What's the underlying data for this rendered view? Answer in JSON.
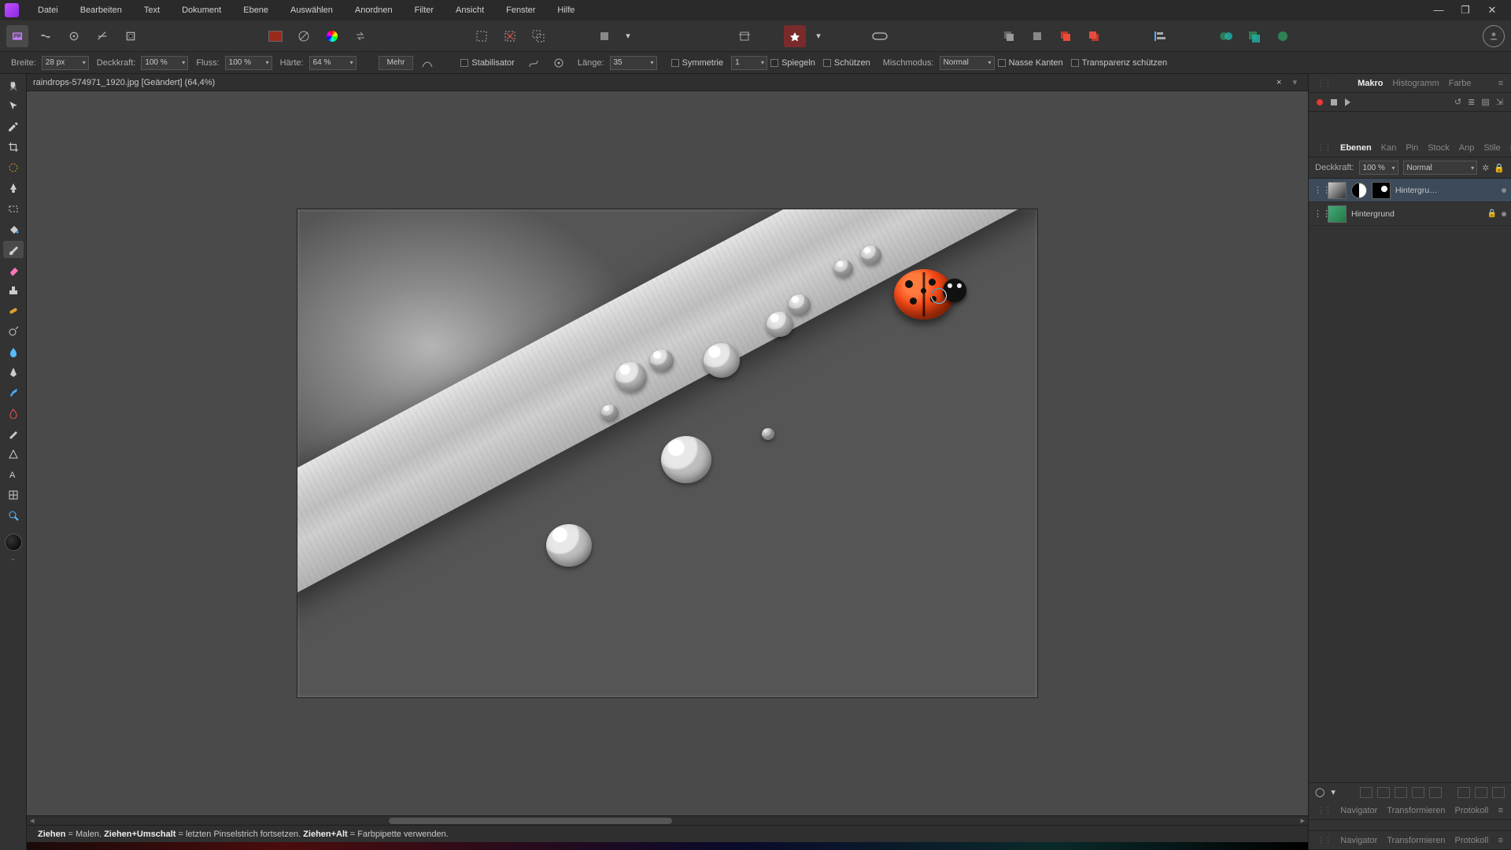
{
  "menubar": [
    "Datei",
    "Bearbeiten",
    "Text",
    "Dokument",
    "Ebene",
    "Auswählen",
    "Anordnen",
    "Filter",
    "Ansicht",
    "Fenster",
    "Hilfe"
  ],
  "doc": {
    "title": "raindrops-574971_1920.jpg [Geändert] (64,4%)"
  },
  "options": {
    "breite_label": "Breite:",
    "breite_value": "28 px",
    "deckkraft_label": "Deckkraft:",
    "deckkraft_value": "100 %",
    "fluss_label": "Fluss:",
    "fluss_value": "100 %",
    "haerte_label": "Härte:",
    "haerte_value": "64 %",
    "mehr": "Mehr",
    "stabilisator": "Stabilisator",
    "laenge_label": "Länge:",
    "laenge_value": "35",
    "symmetrie": "Symmetrie",
    "symmetrie_value": "1",
    "spiegeln": "Spiegeln",
    "schuetzen": "Schützen",
    "misch_label": "Mischmodus:",
    "misch_value": "Normal",
    "nasse": "Nasse Kanten",
    "transparenz": "Transparenz schützen"
  },
  "panels": {
    "top_tabs": [
      "Makro",
      "Histogramm",
      "Farbe"
    ],
    "layer_tabs": [
      "Ebenen",
      "Kan",
      "Pin",
      "Stock",
      "Anp",
      "Stile"
    ],
    "opacity_label": "Deckkraft:",
    "opacity_value": "100 %",
    "blend_value": "Normal",
    "layers": [
      {
        "name": "Hintergru…",
        "type": "adjustment",
        "selected": true
      },
      {
        "name": "Hintergrund",
        "type": "pixel",
        "locked": true
      }
    ],
    "bottom_tabs": [
      "Navigator",
      "Transformieren",
      "Protokoll"
    ],
    "bottom2_tabs": [
      "Navigator",
      "Transformieren",
      "Protokoll"
    ]
  },
  "status": {
    "s1a": "Ziehen",
    "s1b": " = Malen. ",
    "s2a": "Ziehen+Umschalt",
    "s2b": " = letzten Pinselstrich fortsetzen. ",
    "s3a": "Ziehen+Alt",
    "s3b": " = Farbpipette verwenden."
  }
}
